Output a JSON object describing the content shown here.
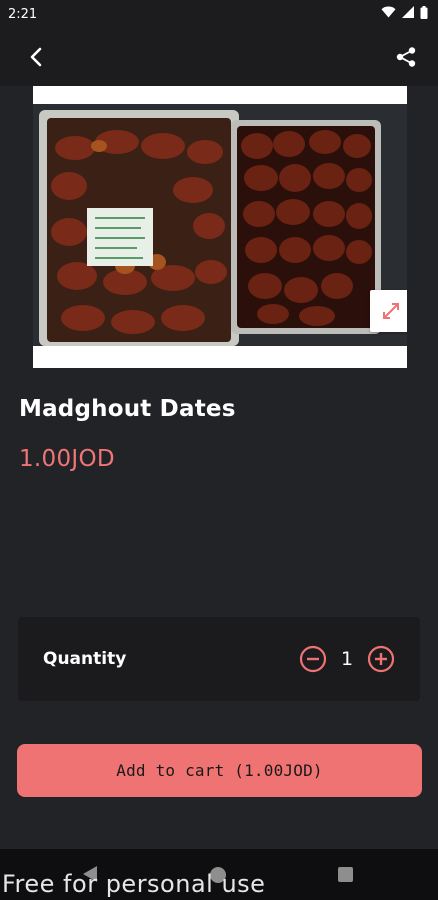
{
  "status_bar": {
    "time": "2:21",
    "icons": [
      "wifi-icon",
      "signal-icon",
      "battery-icon"
    ]
  },
  "app_bar": {
    "back_icon": "back-arrow-icon",
    "share_icon": "share-icon"
  },
  "product": {
    "title": "Madghout Dates",
    "price": "1.00JOD",
    "image_alt": "Madghout Dates",
    "expand_icon": "expand-icon"
  },
  "quantity": {
    "label": "Quantity",
    "value": "1",
    "decrement_icon": "minus-circle-icon",
    "increment_icon": "plus-circle-icon"
  },
  "cart": {
    "add_label": "Add to cart (1.00JOD)"
  },
  "nav_bar": {
    "icons": [
      "nav-back-icon",
      "nav-home-icon",
      "nav-recents-icon"
    ]
  },
  "watermark": "Free for personal use",
  "colors": {
    "background": "#222327",
    "accent": "#f07373",
    "price": "#f07575",
    "panel": "#1b1b1e"
  }
}
